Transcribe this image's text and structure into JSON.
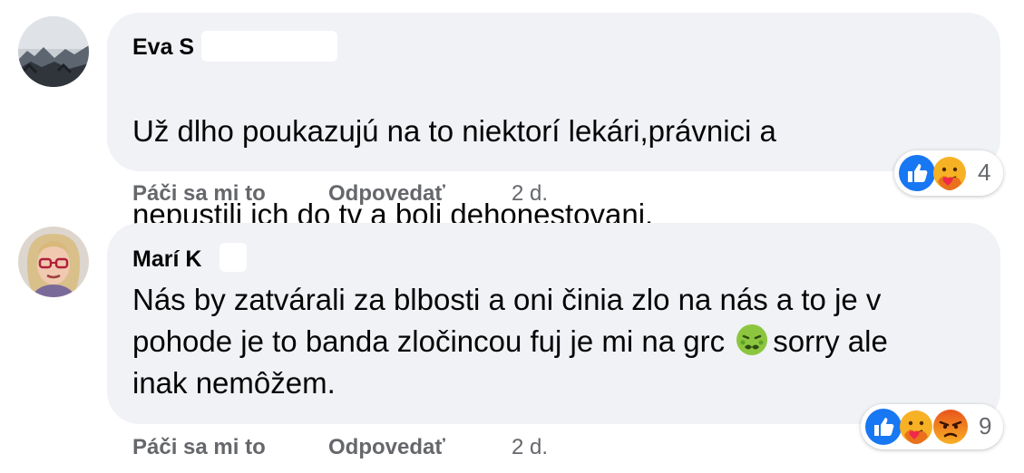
{
  "comments": [
    {
      "author": "Eva S",
      "lines": [
        "Už dlho poukazujú na to niektorí lekári,právnici a",
        "nepustili ich do tv a boli dehonestovani."
      ],
      "like_label": "Páči sa mi to",
      "reply_label": "Odpovedať",
      "time": "2 d.",
      "reactions": [
        "like-icon",
        "care-icon"
      ],
      "reaction_count": "4"
    },
    {
      "author": "Marí K",
      "lines_before_emoji": "Nás by zatvárali za blbosti a oni činia zlo na nás a to je v\npohode je to banda zločincou fuj je mi na grc ",
      "emoji": "nauseated-face-icon",
      "lines_after_emoji": "sorry ale\ninak nemôžem.",
      "like_label": "Páči sa mi to",
      "reply_label": "Odpovedať",
      "time": "2 d.",
      "reactions": [
        "like-icon",
        "care-icon",
        "angry-icon"
      ],
      "reaction_count": "9"
    }
  ],
  "colors": {
    "bubble": "#f0f2f5",
    "like_blue": "#1877f2",
    "secondary_text": "#65676b"
  }
}
